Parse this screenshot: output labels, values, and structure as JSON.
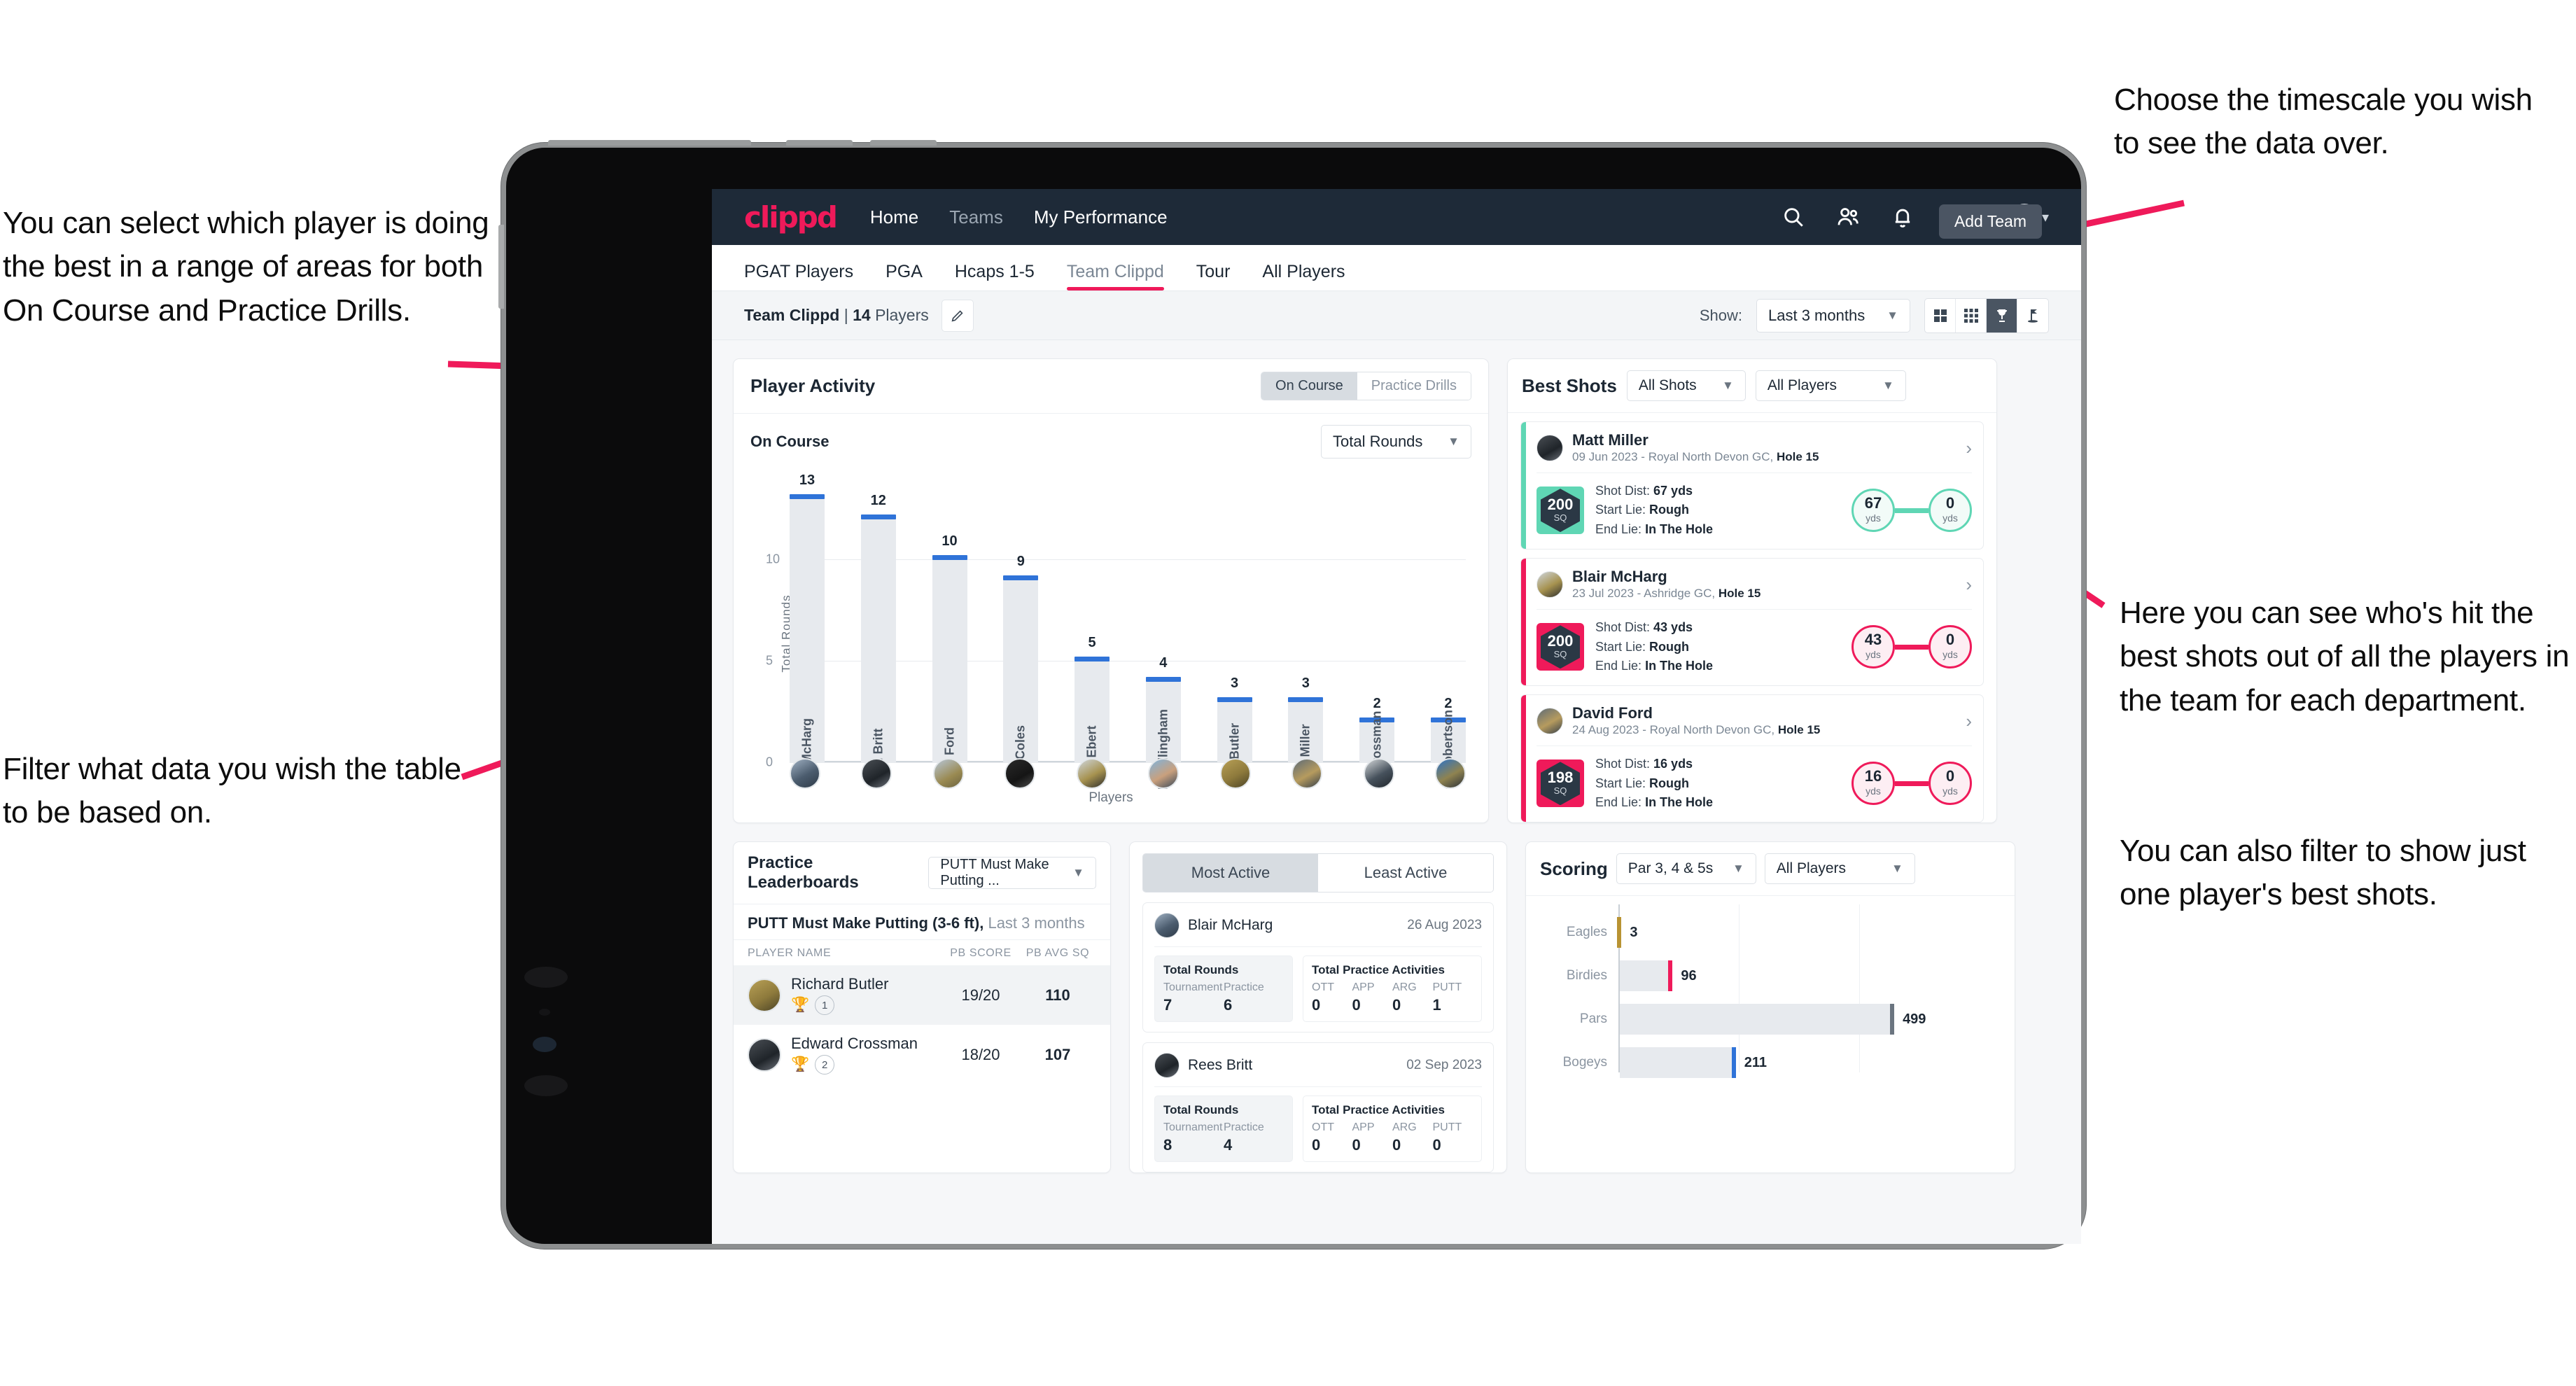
{
  "annotations": {
    "timescale": "Choose the timescale you wish to see the data over.",
    "select_player": "You can select which player is doing the best in a range of areas for both On Course and Practice Drills.",
    "filter": "Filter what data you wish the table to be based on.",
    "best_shots": "Here you can see who's hit the best shots out of all the players in the team for each department.",
    "best_shots_2": "You can also filter to show just one player's best shots."
  },
  "navbar": {
    "logo": "clippd",
    "links": [
      {
        "label": "Home",
        "dim": false
      },
      {
        "label": "Teams",
        "dim": true
      },
      {
        "label": "My Performance",
        "dim": false
      }
    ],
    "icons": [
      "search-icon",
      "people-icon",
      "bell-icon",
      "plus-circle-icon",
      "avatar"
    ]
  },
  "tabbar": {
    "tabs": [
      {
        "label": "PGAT Players",
        "active": false
      },
      {
        "label": "PGA",
        "active": false
      },
      {
        "label": "Hcaps 1-5",
        "active": false
      },
      {
        "label": "Team Clippd",
        "active": true
      },
      {
        "label": "Tour",
        "active": false
      },
      {
        "label": "All Players",
        "active": false
      }
    ],
    "tooltip": "Add Team"
  },
  "toolbar": {
    "team_name": "Team Clippd",
    "separator": "|",
    "player_count": "14",
    "players_word": "Players",
    "edit_icon": "pencil-icon",
    "show_label": "Show:",
    "timescale_value": "Last 3 months",
    "views": [
      {
        "icon": "grid-2x2-icon",
        "active": false
      },
      {
        "icon": "grid-3x3-icon",
        "active": false
      },
      {
        "icon": "trophy-icon",
        "active": true
      },
      {
        "icon": "golf-flag-icon",
        "active": false
      }
    ]
  },
  "player_activity": {
    "title": "Player Activity",
    "segments": [
      {
        "label": "On Course",
        "active": true
      },
      {
        "label": "Practice Drills",
        "active": false
      }
    ],
    "subtitle": "On Course",
    "metric_select": "Total Rounds"
  },
  "chart_data": [
    {
      "type": "bar",
      "title": "Player Activity",
      "xlabel": "Players",
      "ylabel": "Total Rounds",
      "categories": [
        "B. McHarg",
        "R. Britt",
        "D. Ford",
        "J. Coles",
        "E. Ebert",
        "D. Billingham",
        "R. Butler",
        "M. Miller",
        "E. Crossman",
        "C. Robertson"
      ],
      "values": [
        13,
        12,
        10,
        9,
        5,
        4,
        3,
        3,
        2,
        2
      ],
      "yticks": [
        0,
        5,
        10
      ],
      "ylim": [
        0,
        14
      ],
      "grid": true
    },
    {
      "type": "bar",
      "orientation": "horizontal",
      "title": "Scoring",
      "categories": [
        "Eagles",
        "Birdies",
        "Pars",
        "Bogeys"
      ],
      "values": [
        3,
        96,
        499,
        211
      ],
      "colors": [
        "#b89333",
        "#ef1a5a",
        "#6b7580",
        "#2f73d8"
      ],
      "xlim": [
        0,
        560
      ],
      "grid": true
    }
  ],
  "best_shots": {
    "title": "Best Shots",
    "shot_filter": "All Shots",
    "player_filter": "All Players",
    "shots": [
      {
        "player": "Matt Miller",
        "meta_date": "09 Jun 2023 - Royal North Devon GC,",
        "meta_hole": "Hole 15",
        "sq": "200",
        "sq_unit": "SQ",
        "accent": "teal",
        "shot_dist_label": "Shot Dist:",
        "shot_dist": "67 yds",
        "start_lie_label": "Start Lie:",
        "start_lie": "Rough",
        "end_lie_label": "End Lie:",
        "end_lie": "In The Hole",
        "from_val": "67",
        "from_unit": "yds",
        "to_val": "0",
        "to_unit": "yds"
      },
      {
        "player": "Blair McHarg",
        "meta_date": "23 Jul 2023 - Ashridge GC,",
        "meta_hole": "Hole 15",
        "sq": "200",
        "sq_unit": "SQ",
        "accent": "pink",
        "shot_dist_label": "Shot Dist:",
        "shot_dist": "43 yds",
        "start_lie_label": "Start Lie:",
        "start_lie": "Rough",
        "end_lie_label": "End Lie:",
        "end_lie": "In The Hole",
        "from_val": "43",
        "from_unit": "yds",
        "to_val": "0",
        "to_unit": "yds"
      },
      {
        "player": "David Ford",
        "meta_date": "24 Aug 2023 - Royal North Devon GC,",
        "meta_hole": "Hole 15",
        "sq": "198",
        "sq_unit": "SQ",
        "accent": "pink",
        "shot_dist_label": "Shot Dist:",
        "shot_dist": "16 yds",
        "start_lie_label": "Start Lie:",
        "start_lie": "Rough",
        "end_lie_label": "End Lie:",
        "end_lie": "In The Hole",
        "from_val": "16",
        "from_unit": "yds",
        "to_val": "0",
        "to_unit": "yds"
      }
    ]
  },
  "practice_leaderboards": {
    "title": "Practice Leaderboards",
    "drill_select": "PUTT Must Make Putting ...",
    "subtitle_bold": "PUTT Must Make Putting (3-6 ft),",
    "subtitle_dim": "Last 3 months",
    "columns": [
      "PLAYER NAME",
      "PB SCORE",
      "PB AVG SQ"
    ],
    "rows": [
      {
        "name": "Richard Butler",
        "trophy": "gold",
        "rank": "1",
        "pb_score": "19/20",
        "pb_avg_sq": "110",
        "highlight": true
      },
      {
        "name": "Edward Crossman",
        "trophy": "silver",
        "rank": "2",
        "pb_score": "18/20",
        "pb_avg_sq": "107",
        "highlight": false
      }
    ]
  },
  "activity": {
    "tabs": [
      {
        "label": "Most Active",
        "active": true
      },
      {
        "label": "Least Active",
        "active": false
      }
    ],
    "cards": [
      {
        "name": "Blair McHarg",
        "date": "26 Aug 2023",
        "rounds_title": "Total Rounds",
        "rounds_keys": [
          "Tournament",
          "Practice"
        ],
        "rounds_vals": [
          "7",
          "6"
        ],
        "practice_title": "Total Practice Activities",
        "practice_keys": [
          "OTT",
          "APP",
          "ARG",
          "PUTT"
        ],
        "practice_vals": [
          "0",
          "0",
          "0",
          "1"
        ]
      },
      {
        "name": "Rees Britt",
        "date": "02 Sep 2023",
        "rounds_title": "Total Rounds",
        "rounds_keys": [
          "Tournament",
          "Practice"
        ],
        "rounds_vals": [
          "8",
          "4"
        ],
        "practice_title": "Total Practice Activities",
        "practice_keys": [
          "OTT",
          "APP",
          "ARG",
          "PUTT"
        ],
        "practice_vals": [
          "0",
          "0",
          "0",
          "0"
        ]
      }
    ]
  },
  "scoring": {
    "title": "Scoring",
    "par_filter": "Par 3, 4 & 5s",
    "player_filter": "All Players"
  },
  "colors": {
    "brand_pink": "#ef1a5a",
    "navy": "#1e2a38",
    "bar_blue": "#2f73d8",
    "teal": "#5fd6b4",
    "bar_grey": "#e7eaee"
  }
}
